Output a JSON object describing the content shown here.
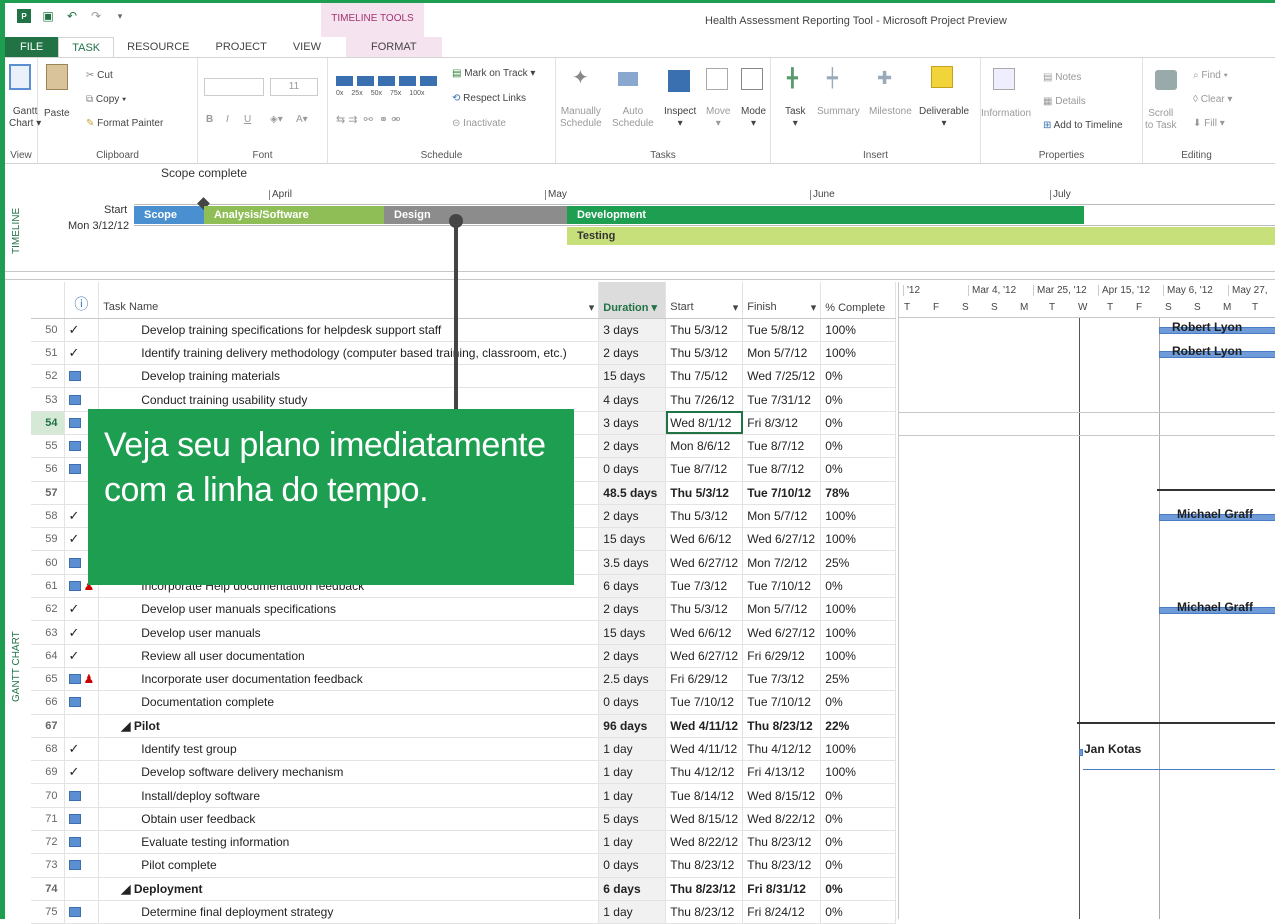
{
  "titlebar": {
    "contextual_tab": "TIMELINE TOOLS",
    "window_title": "Health Assessment Reporting Tool - Microsoft Project Preview"
  },
  "tabs": [
    "FILE",
    "TASK",
    "RESOURCE",
    "PROJECT",
    "VIEW",
    "FORMAT"
  ],
  "ribbon": {
    "view": {
      "gantt_label": "Gantt",
      "chart_label": "Chart ▾",
      "group": "View"
    },
    "clipboard": {
      "cut": "Cut",
      "copy": "Copy ▾",
      "paste": "Paste",
      "format_painter": "Format Painter",
      "group": "Clipboard"
    },
    "font": {
      "size": "11",
      "group": "Font"
    },
    "schedule": {
      "mark_on_track": "Mark on Track ▾",
      "respect_links": "Respect Links",
      "inactivate": "Inactivate",
      "group": "Schedule",
      "percents": [
        "0x",
        "25x",
        "50x",
        "75x",
        "100x"
      ]
    },
    "tasks": {
      "manually": "Manually",
      "auto": "Auto",
      "schedule": "Schedule",
      "inspect": "Inspect",
      "move": "Move",
      "mode": "Mode",
      "group": "Tasks"
    },
    "insert": {
      "task": "Task",
      "summary": "Summary",
      "milestone": "Milestone",
      "deliverable": "Deliverable",
      "group": "Insert"
    },
    "properties": {
      "information": "Information",
      "notes": "Notes",
      "details": "Details",
      "add_to_timeline": "Add to Timeline",
      "group": "Properties"
    },
    "editing": {
      "scroll": "Scroll",
      "to_task": "to Task",
      "find": "Find ▾",
      "clear": "Clear ▾",
      "fill": "Fill ▾",
      "group": "Editing"
    }
  },
  "timeline": {
    "side_label": "TIMELINE",
    "milestone": "Scope complete",
    "start_label": "Start",
    "start_date": "Mon 3/12/12",
    "months": [
      "April",
      "May",
      "June",
      "July"
    ],
    "bars": {
      "scope": "Scope",
      "analysis": "Analysis/Software",
      "design": "Design",
      "development": "Development",
      "testing": "Testing"
    },
    "colors": {
      "scope": "#4a8fcf",
      "analysis": "#8fbe57",
      "design": "#8c8c8c",
      "development": "#1e9e50",
      "testing": "#c7e07a"
    }
  },
  "gantt": {
    "side_label": "GANTT CHART",
    "columns": {
      "info": "ⓘ",
      "name": "Task Name",
      "duration": "Duration",
      "start": "Start",
      "finish": "Finish",
      "complete": "% Complete"
    },
    "rows": [
      {
        "id": "50",
        "ind": "check",
        "name": "Develop training specifications for helpdesk support staff",
        "dur": "3 days",
        "start": "Thu 5/3/12",
        "finish": "Tue 5/8/12",
        "pct": "100%"
      },
      {
        "id": "51",
        "ind": "check",
        "name": "Identify training delivery methodology (computer based training, classroom, etc.)",
        "dur": "2 days",
        "start": "Thu 5/3/12",
        "finish": "Mon 5/7/12",
        "pct": "100%"
      },
      {
        "id": "52",
        "ind": "cal",
        "name": "Develop training materials",
        "dur": "15 days",
        "start": "Thu 7/5/12",
        "finish": "Wed 7/25/12",
        "pct": "0%"
      },
      {
        "id": "53",
        "ind": "cal",
        "name": "Conduct training usability study",
        "dur": "4 days",
        "start": "Thu 7/26/12",
        "finish": "Tue 7/31/12",
        "pct": "0%"
      },
      {
        "id": "54",
        "ind": "cal",
        "name": "",
        "dur": "3 days",
        "start": "Wed 8/1/12",
        "finish": "Fri 8/3/12",
        "pct": "0%"
      },
      {
        "id": "55",
        "ind": "cal",
        "name": "",
        "dur": "2 days",
        "start": "Mon 8/6/12",
        "finish": "Tue 8/7/12",
        "pct": "0%"
      },
      {
        "id": "56",
        "ind": "cal",
        "name": "",
        "dur": "0 days",
        "start": "Tue 8/7/12",
        "finish": "Tue 8/7/12",
        "pct": "0%"
      },
      {
        "id": "57",
        "ind": "",
        "name": "",
        "dur": "48.5 days",
        "start": "Thu 5/3/12",
        "finish": "Tue 7/10/12",
        "pct": "78%",
        "bold": true
      },
      {
        "id": "58",
        "ind": "check",
        "name": "",
        "dur": "2 days",
        "start": "Thu 5/3/12",
        "finish": "Mon 5/7/12",
        "pct": "100%"
      },
      {
        "id": "59",
        "ind": "check",
        "name": "",
        "dur": "15 days",
        "start": "Wed 6/6/12",
        "finish": "Wed 6/27/12",
        "pct": "100%"
      },
      {
        "id": "60",
        "ind": "cal",
        "name": "",
        "dur": "3.5 days",
        "start": "Wed 6/27/12",
        "finish": "Mon 7/2/12",
        "pct": "25%"
      },
      {
        "id": "61",
        "ind": "calp",
        "name": "Incorporate Help documentation feedback",
        "dur": "6 days",
        "start": "Tue 7/3/12",
        "finish": "Tue 7/10/12",
        "pct": "0%"
      },
      {
        "id": "62",
        "ind": "check",
        "name": "Develop user manuals specifications",
        "dur": "2 days",
        "start": "Thu 5/3/12",
        "finish": "Mon 5/7/12",
        "pct": "100%"
      },
      {
        "id": "63",
        "ind": "check",
        "name": "Develop user manuals",
        "dur": "15 days",
        "start": "Wed 6/6/12",
        "finish": "Wed 6/27/12",
        "pct": "100%"
      },
      {
        "id": "64",
        "ind": "check",
        "name": "Review all user documentation",
        "dur": "2 days",
        "start": "Wed 6/27/12",
        "finish": "Fri 6/29/12",
        "pct": "100%"
      },
      {
        "id": "65",
        "ind": "calp",
        "name": "Incorporate user documentation feedback",
        "dur": "2.5 days",
        "start": "Fri 6/29/12",
        "finish": "Tue 7/3/12",
        "pct": "25%"
      },
      {
        "id": "66",
        "ind": "cal",
        "name": "Documentation complete",
        "dur": "0 days",
        "start": "Tue 7/10/12",
        "finish": "Tue 7/10/12",
        "pct": "0%"
      },
      {
        "id": "67",
        "ind": "",
        "name": "◢ Pilot",
        "dur": "96 days",
        "start": "Wed 4/11/12",
        "finish": "Thu 8/23/12",
        "pct": "22%",
        "bold": true,
        "summary": true
      },
      {
        "id": "68",
        "ind": "check",
        "name": "Identify test group",
        "dur": "1 day",
        "start": "Wed 4/11/12",
        "finish": "Thu 4/12/12",
        "pct": "100%"
      },
      {
        "id": "69",
        "ind": "check",
        "name": "Develop software delivery mechanism",
        "dur": "1 day",
        "start": "Thu 4/12/12",
        "finish": "Fri 4/13/12",
        "pct": "100%"
      },
      {
        "id": "70",
        "ind": "cal",
        "name": "Install/deploy software",
        "dur": "1 day",
        "start": "Tue 8/14/12",
        "finish": "Wed 8/15/12",
        "pct": "0%"
      },
      {
        "id": "71",
        "ind": "cal",
        "name": "Obtain user feedback",
        "dur": "5 days",
        "start": "Wed 8/15/12",
        "finish": "Wed 8/22/12",
        "pct": "0%"
      },
      {
        "id": "72",
        "ind": "cal",
        "name": "Evaluate testing information",
        "dur": "1 day",
        "start": "Wed 8/22/12",
        "finish": "Thu 8/23/12",
        "pct": "0%"
      },
      {
        "id": "73",
        "ind": "cal",
        "name": "Pilot complete",
        "dur": "0 days",
        "start": "Thu 8/23/12",
        "finish": "Thu 8/23/12",
        "pct": "0%"
      },
      {
        "id": "74",
        "ind": "",
        "name": "◢ Deployment",
        "dur": "6 days",
        "start": "Thu 8/23/12",
        "finish": "Fri 8/31/12",
        "pct": "0%",
        "bold": true,
        "summary": true
      },
      {
        "id": "75",
        "ind": "cal",
        "name": "Determine final deployment strategy",
        "dur": "1 day",
        "start": "Thu 8/23/12",
        "finish": "Fri 8/24/12",
        "pct": "0%"
      }
    ],
    "chart_weeks": [
      "'12",
      "Mar 4, '12",
      "Mar 25, '12",
      "Apr 15, '12",
      "May 6, '12",
      "May 27,"
    ],
    "chart_days": [
      "T",
      "F",
      "S",
      "S",
      "M",
      "T",
      "W",
      "T",
      "F",
      "S",
      "S",
      "M",
      "T"
    ],
    "resources": {
      "r50": "Robert Lyon",
      "r51": "Robert Lyon",
      "r58": "Michael Graff",
      "r62": "Michael Graff",
      "r68": "Jan Kotas"
    }
  },
  "callout": {
    "text": "Veja seu plano imediatamente com a linha do tempo."
  }
}
